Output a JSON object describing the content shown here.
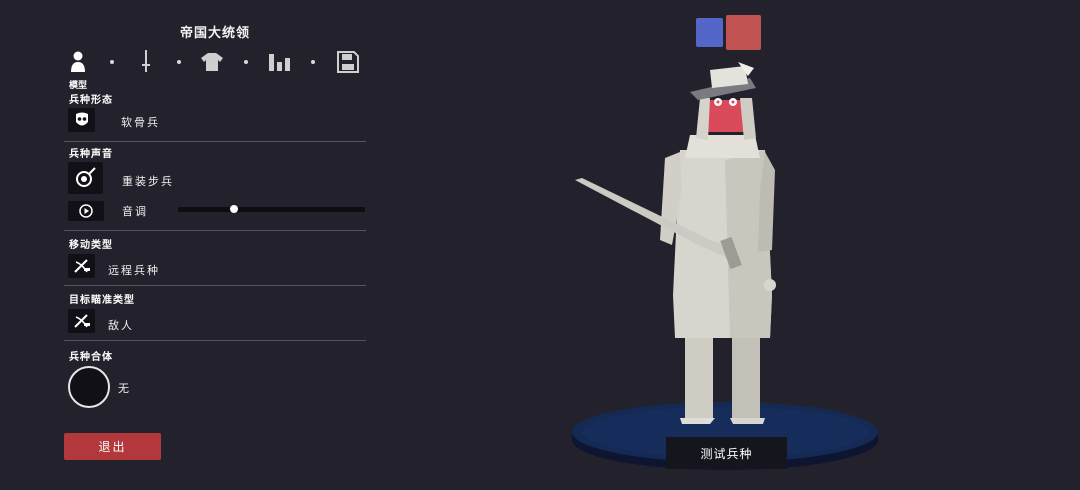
{
  "header": {
    "title": "帝国大统领"
  },
  "tabs": [
    {
      "icon": "person-icon",
      "label": "模型"
    },
    {
      "icon": "sword-icon"
    },
    {
      "icon": "shirt-icon"
    },
    {
      "icon": "stats-icon"
    },
    {
      "icon": "save-icon"
    }
  ],
  "sections": {
    "form": {
      "title": "兵种形态",
      "value": "软骨兵"
    },
    "voice": {
      "title": "兵种声音",
      "value": "重装步兵",
      "pitch_label": "音调",
      "pitch_level": 0.3
    },
    "movement": {
      "title": "移动类型",
      "value": "远程兵种"
    },
    "targeting": {
      "title": "目标瞄准类型",
      "value": "敌人"
    },
    "fusion": {
      "title": "兵种合体",
      "value": "无"
    }
  },
  "exit_button": {
    "label": "退出"
  },
  "test_button": {
    "label": "测试兵种"
  },
  "colors": {
    "team_blue": "#5466c8",
    "team_red": "#c05252",
    "exit": "#b2383b",
    "background": "#23222c"
  }
}
